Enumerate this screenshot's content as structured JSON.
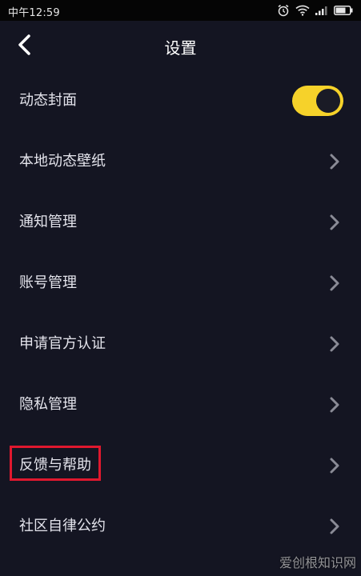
{
  "status_bar": {
    "time": "中午12:59",
    "icons": [
      "alarm-icon",
      "wifi-icon",
      "signal-icon",
      "battery-icon"
    ]
  },
  "header": {
    "title": "设置",
    "back_icon": "chevron-left-icon"
  },
  "settings": {
    "items": [
      {
        "label": "动态封面",
        "control": "toggle",
        "toggle_on": true
      },
      {
        "label": "本地动态壁纸",
        "control": "chevron"
      },
      {
        "label": "通知管理",
        "control": "chevron"
      },
      {
        "label": "账号管理",
        "control": "chevron"
      },
      {
        "label": "申请官方认证",
        "control": "chevron"
      },
      {
        "label": "隐私管理",
        "control": "chevron"
      },
      {
        "label": "反馈与帮助",
        "control": "chevron",
        "highlighted": true
      },
      {
        "label": "社区自律公约",
        "control": "chevron"
      }
    ]
  },
  "watermark": {
    "text": "爱创根知识网"
  },
  "colors": {
    "background": "#141522",
    "toggle_on": "#f6d22a",
    "highlight_border": "#e0182e",
    "text": "#e4e4ec"
  }
}
